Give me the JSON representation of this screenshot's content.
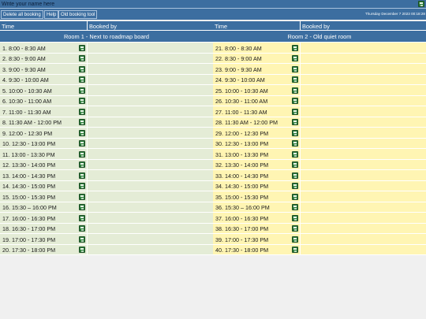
{
  "topbar": {
    "name_placeholder": "Write your name here",
    "save_icon": "save-icon"
  },
  "menu": {
    "items": [
      "Delete all booking",
      "Help",
      "Old booking tool"
    ],
    "datetime": "Thursday December 7 2023 00:18:28"
  },
  "table": {
    "col_time": "Time",
    "col_booked_by": "Booked by"
  },
  "rooms": [
    {
      "name": "Room 1 - Next to roadmap board",
      "color": "#e4ecd6",
      "slots": [
        "1. 8:00 - 8:30 AM",
        "2. 8:30 - 9:00 AM",
        "3. 9:00 - 9:30 AM",
        "4. 9:30 - 10:00 AM",
        "5. 10:00 - 10:30 AM",
        "6. 10:30 - 11:00 AM",
        "7. 11:00 - 11:30 AM",
        "8. 11:30 AM - 12:00 PM",
        "9. 12:00 - 12:30 PM",
        "10. 12:30 - 13:00 PM",
        "11. 13:00 - 13:30 PM",
        "12. 13:30 - 14:00 PM",
        "13. 14:00 - 14:30 PM",
        "14. 14:30 - 15:00 PM",
        "15. 15:00 - 15:30 PM",
        "16. 15:30 – 16:00 PM",
        "17. 16:00 - 16:30 PM",
        "18. 16:30 - 17:00 PM",
        "19. 17:00 - 17:30 PM",
        "20. 17:30 - 18:00 PM"
      ]
    },
    {
      "name": "Room 2 - Old quiet room",
      "color": "#fff5b3",
      "slots": [
        "21. 8:00 - 8:30 AM",
        "22. 8:30 - 9:00 AM",
        "23. 9:00 - 9:30 AM",
        "24. 9:30 - 10:00 AM",
        "25. 10:00 - 10:30 AM",
        "26. 10:30 - 11:00 AM",
        "27. 11:00 - 11:30 AM",
        "28. 11:30 AM - 12:00 PM",
        "29. 12:00 - 12:30 PM",
        "30. 12:30 - 13:00 PM",
        "31. 13:00 - 13:30 PM",
        "32. 13:30 - 14:00 PM",
        "33. 14:00 - 14:30 PM",
        "34. 14:30 - 15:00 PM",
        "35. 15:00 - 15:30 PM",
        "36. 15:30 – 16:00 PM",
        "37. 16:00 - 16:30 PM",
        "38. 16:30 - 17:00 PM",
        "39. 17:00 - 17:30 PM",
        "40. 17:30 - 18:00 PM"
      ]
    }
  ],
  "colors": {
    "header": "#3c6ea0",
    "save_icon": "#2f7d3c"
  }
}
